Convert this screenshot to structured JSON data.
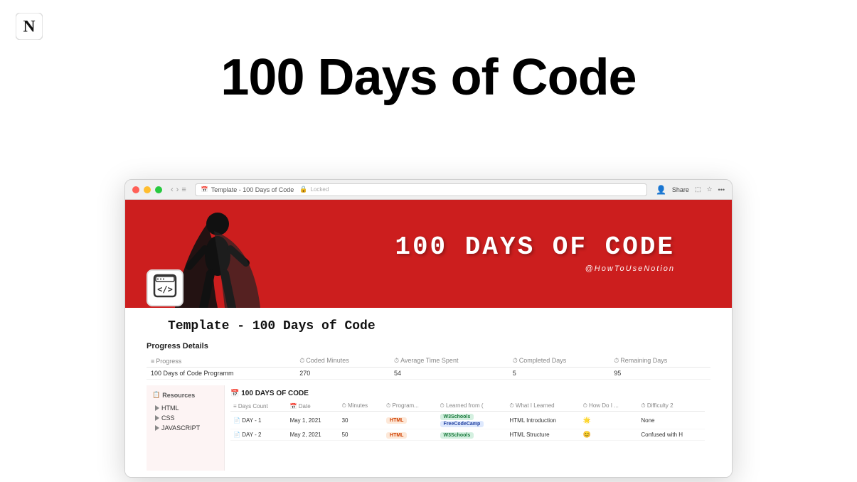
{
  "notion_logo": "N",
  "main_title": "100 Days of Code",
  "browser": {
    "address_bar_text": "Template - 100 Days of Code",
    "address_locked": "Locked",
    "share_label": "Share"
  },
  "hero": {
    "title": "100 DAYS OF CODE",
    "subtitle": "@HowToUseNotion"
  },
  "page": {
    "title": "Template - 100 Days of Code",
    "section_progress": "Progress Details",
    "progress_columns": [
      "Progress",
      "Coded Minutes",
      "Average Time Spent",
      "Completed Days",
      "Remaining Days"
    ],
    "progress_row": {
      "name": "100 Days of Code Programm",
      "coded_minutes": "270",
      "avg_time": "54",
      "completed": "5",
      "remaining": "95"
    }
  },
  "sidebar": {
    "label": "Resources",
    "items": [
      "HTML",
      "CSS",
      "JAVASCRIPT"
    ]
  },
  "data_table": {
    "title": "📅 100 DAYS OF CODE",
    "columns": [
      "Days Count",
      "Date",
      "Minutes",
      "Program...",
      "Learned from (",
      "What I Learned",
      "How Do I ...",
      "Difficulty 2"
    ],
    "rows": [
      {
        "day": "DAY - 1",
        "date": "May 1, 2021",
        "minutes": "30",
        "program": "HTML",
        "learned_from_1": "W3Schools",
        "learned_from_2": "FreeCodeCamp",
        "what_learned": "HTML Introduction",
        "how": "🌟",
        "difficulty": "None"
      },
      {
        "day": "DAY - 2",
        "date": "May 2, 2021",
        "minutes": "50",
        "program": "HTML",
        "learned_from_1": "W3Schools",
        "learned_from_2": "",
        "what_learned": "HTML Structure",
        "how": "😊",
        "difficulty": "Confused with H"
      }
    ]
  }
}
